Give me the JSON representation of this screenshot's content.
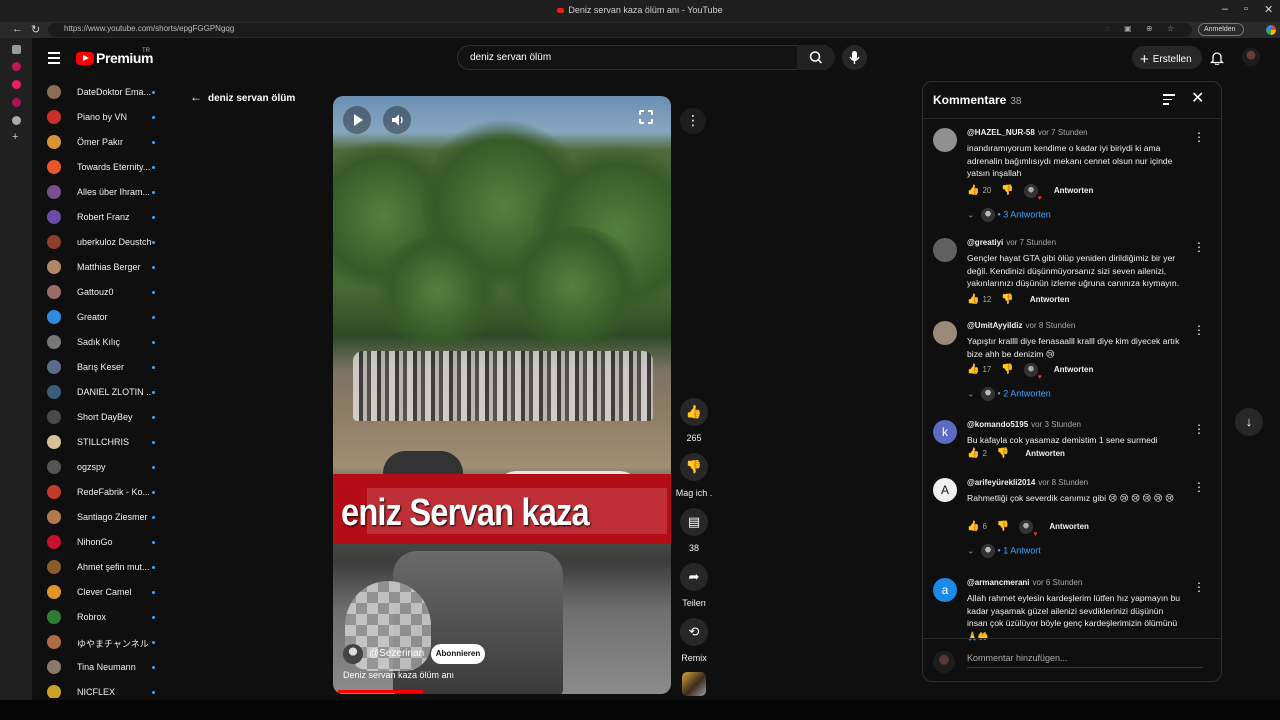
{
  "browser": {
    "window_title": "Deniz servan kaza ölüm anı - YouTube",
    "url": "https://www.youtube.com/shorts/epgFGGPNgqg",
    "login_label": "Anmelden"
  },
  "masthead": {
    "logo_text": "Premium",
    "logo_tm": "TR",
    "search_value": "deniz servan ölüm",
    "create_label": "Erstellen"
  },
  "subscriptions": [
    {
      "name": "",
      "color": "#6b6b6b"
    },
    {
      "name": "DateDoktor Ema...",
      "color": "#8a6b55"
    },
    {
      "name": "Piano by VN",
      "color": "#c9302c"
    },
    {
      "name": "Ömer Pakır",
      "color": "#d69436"
    },
    {
      "name": "Towards Eternity...",
      "color": "#e8572a"
    },
    {
      "name": "Alles über Ihram...",
      "color": "#7a4f8e"
    },
    {
      "name": "Robert Franz",
      "color": "#6b4aa8"
    },
    {
      "name": "uberkuloz Deustch",
      "color": "#8c3f2b"
    },
    {
      "name": "Matthias Berger",
      "color": "#b08868"
    },
    {
      "name": "Gattouz0",
      "color": "#9b6b6b"
    },
    {
      "name": "Greator",
      "color": "#2f8ce0"
    },
    {
      "name": "Sadık Kılıç",
      "color": "#777777"
    },
    {
      "name": "Barış Keser",
      "color": "#5a6c8a"
    },
    {
      "name": "DANIEL ZLOTIN ...",
      "color": "#3c5a7a"
    },
    {
      "name": "Short DayBey",
      "color": "#4a4a4a"
    },
    {
      "name": "STILLCHRIS",
      "color": "#d8c19a"
    },
    {
      "name": "ogzspy",
      "color": "#555555"
    },
    {
      "name": "RedeFabrik - Ko...",
      "color": "#c0392b"
    },
    {
      "name": "Santiago Ziesmer",
      "color": "#b07a4a"
    },
    {
      "name": "NihonGo",
      "color": "#c8102e"
    },
    {
      "name": "Ahmet şefin mut...",
      "color": "#8a5a2b"
    },
    {
      "name": "Clever Camel",
      "color": "#e0962b"
    },
    {
      "name": "Robrox",
      "color": "#2e7d32"
    },
    {
      "name": "ゆやまチャンネル",
      "color": "#ad6b4a"
    },
    {
      "name": "Tina Neumann",
      "color": "#8a7a6b"
    },
    {
      "name": "NICFLEX",
      "color": "#c9a227"
    }
  ],
  "back_header": "deniz servan ölüm",
  "video": {
    "caption": "eniz Servan kaza",
    "channel": "@Sezerinan",
    "subscribe_label": "Abonnieren",
    "title": "Deniz servan kaza ölüm anı",
    "progress_fraction": 0.25
  },
  "actions": {
    "likes": "265",
    "dislike_label": "Mag ich .",
    "comments_count": "38",
    "share_label": "Teilen",
    "remix_label": "Remix"
  },
  "comments_panel": {
    "title": "Kommentare",
    "count": "38",
    "reply_label": "Antworten",
    "input_placeholder": "Kommentar hinzufügen...",
    "comments": [
      {
        "author": "@HAZEL_NUR-58",
        "time": "vor 7 Stunden",
        "text": "inandıramıyorum kendime o kadar iyi biriydi ki ama adrenalin bağımlısıydı mekanı cennet olsun nur içinde yatsın inşallah",
        "likes": "20",
        "replies": "3 Antworten",
        "avatar": "",
        "avatar_color": "#8f8f8f",
        "has_heart": true
      },
      {
        "author": "@greatiyi",
        "time": "vor 7 Stunden",
        "text": "Gençler hayat GTA gibi ölüp yeniden dirildiğimiz bir yer değil. Kendinizi düşünmüyorsanız sizi seven ailenizi, yakınlarınızı düşünün izleme uğruna canınıza kıymayın.",
        "likes": "12",
        "replies": "",
        "avatar": "",
        "avatar_color": "#606060",
        "has_heart": false
      },
      {
        "author": "@UmitAyyildiz",
        "time": "vor 8 Stunden",
        "text": "Yapıştır krallll diye fenasaalll kralll diye kim diyecek artık bize ahh be denizim 😢",
        "likes": "17",
        "replies": "2 Antworten",
        "avatar": "",
        "avatar_color": "#9a8a7a",
        "has_heart": true
      },
      {
        "author": "@komando5195",
        "time": "vor 3 Stunden",
        "text": "Bu kafayla cok yasamaz demistim 1 sene surmedi",
        "likes": "2",
        "replies": "",
        "avatar": "k",
        "avatar_color": "#5c6bc0",
        "has_heart": false
      },
      {
        "author": "@arifeyürekli2014",
        "time": "vor 8 Stunden",
        "text": "Rahmetliği  çok severdik  canımız gibi 😢 😢 😢 😢 😢 😢",
        "likes": "6",
        "replies": "1 Antwort",
        "avatar": "A",
        "avatar_color": "#f1f1f1",
        "has_heart": true
      },
      {
        "author": "@armancmerani",
        "time": "vor 6 Stunden",
        "text": "Allah rahmet eylesin kardeşlerim lütfen hız yapmayın bu kadar yaşamak güzel ailenizi sevdiklerinizi düşünün insan çok üzülüyor böyle genç kardeşlerimizin ölümünü 🙏🤲",
        "likes": "",
        "replies": "",
        "avatar": "a",
        "avatar_color": "#1e88e5",
        "has_heart": false
      }
    ]
  }
}
